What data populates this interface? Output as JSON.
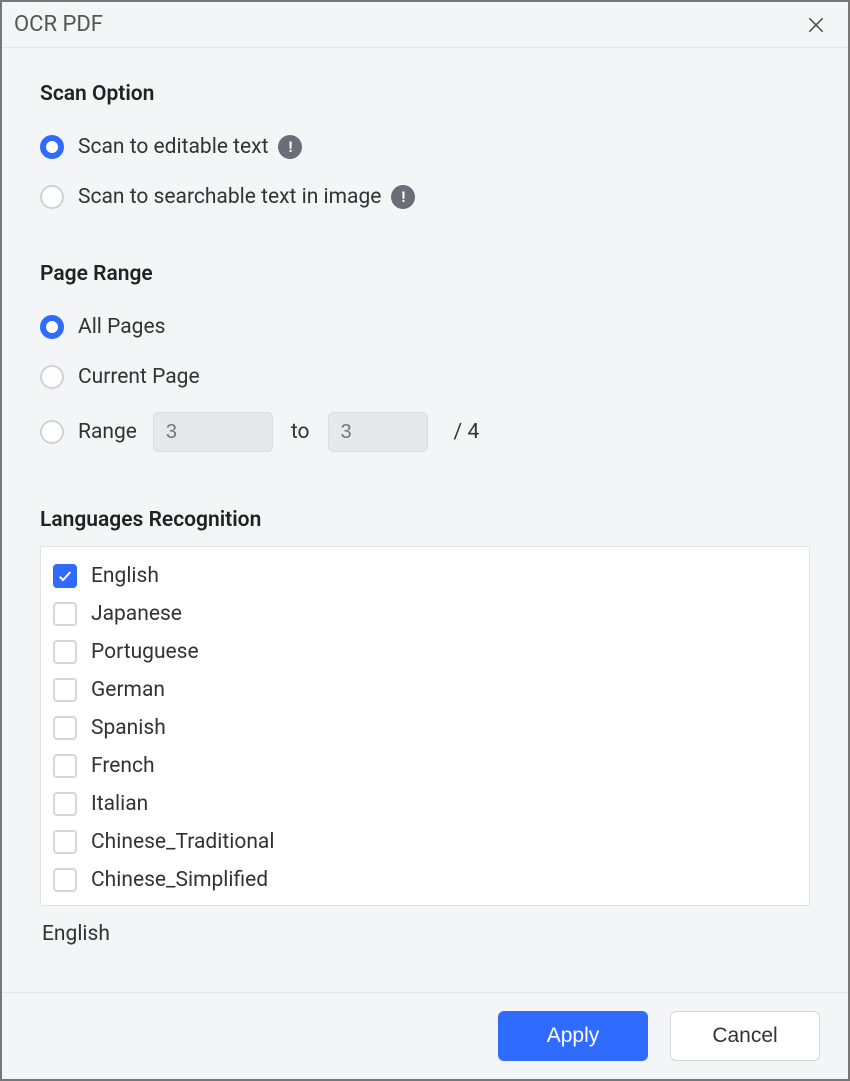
{
  "window": {
    "title": "OCR PDF"
  },
  "scan": {
    "section_title": "Scan Option",
    "options": {
      "editable": {
        "label": "Scan to editable text",
        "selected": true
      },
      "searchable": {
        "label": "Scan to searchable text in image",
        "selected": false
      }
    },
    "info_glyph": "!"
  },
  "page_range": {
    "section_title": "Page Range",
    "all": {
      "label": "All Pages",
      "selected": true
    },
    "current": {
      "label": "Current Page",
      "selected": false
    },
    "range": {
      "label": "Range",
      "selected": false,
      "from_placeholder": "3",
      "to_placeholder": "3",
      "separator": "to",
      "total_prefix": "/",
      "total": "4"
    }
  },
  "languages": {
    "section_title": "Languages Recognition",
    "items": [
      {
        "label": "English",
        "checked": true
      },
      {
        "label": "Japanese",
        "checked": false
      },
      {
        "label": "Portuguese",
        "checked": false
      },
      {
        "label": "German",
        "checked": false
      },
      {
        "label": "Spanish",
        "checked": false
      },
      {
        "label": "French",
        "checked": false
      },
      {
        "label": "Italian",
        "checked": false
      },
      {
        "label": "Chinese_Traditional",
        "checked": false
      },
      {
        "label": "Chinese_Simplified",
        "checked": false
      }
    ],
    "selected_summary": "English"
  },
  "buttons": {
    "apply": "Apply",
    "cancel": "Cancel"
  }
}
